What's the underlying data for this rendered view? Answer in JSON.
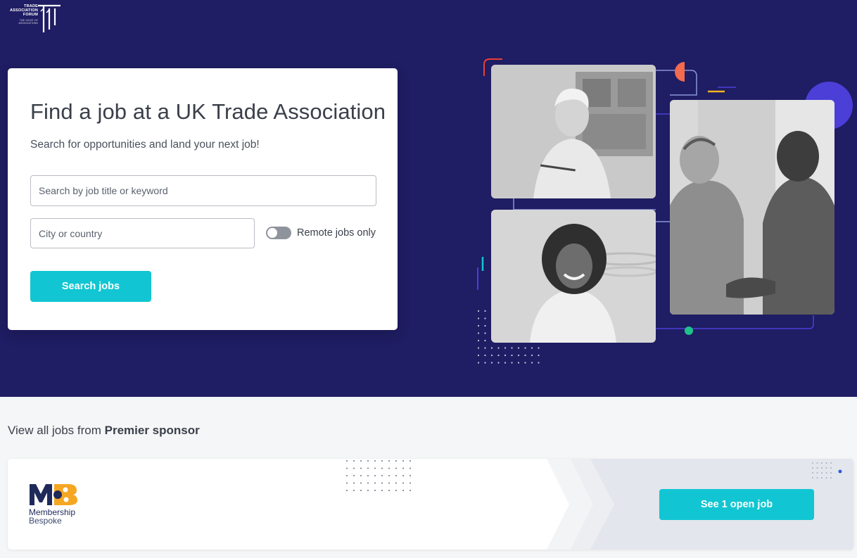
{
  "brand": {
    "logo_lines": [
      "TRADE",
      "ASSOCIATION",
      "FORUM"
    ],
    "logo_tagline": "THE VOICE OF ASSOCIATIONS"
  },
  "hero": {
    "title": "Find a job at a UK Trade Association",
    "subtitle": "Search for opportunities and land your next job!",
    "keyword_placeholder": "Search by job title or keyword",
    "location_placeholder": "City or country",
    "remote_label": "Remote jobs only",
    "remote_enabled": false,
    "search_button": "Search jobs"
  },
  "sponsor": {
    "heading_prefix": "View all jobs from",
    "heading_strong": "Premier sponsor",
    "company_line1": "Membership",
    "company_line2": "Bespoke",
    "cta": "See 1 open job"
  },
  "colors": {
    "hero_bg": "#1f1d63",
    "accent": "#11c6d2",
    "deco_purple": "#4b3fd8",
    "deco_orange": "#f26b4f",
    "deco_green": "#1fc28a",
    "sponsor_navy": "#1f2a5a",
    "sponsor_orange": "#f5a623"
  }
}
